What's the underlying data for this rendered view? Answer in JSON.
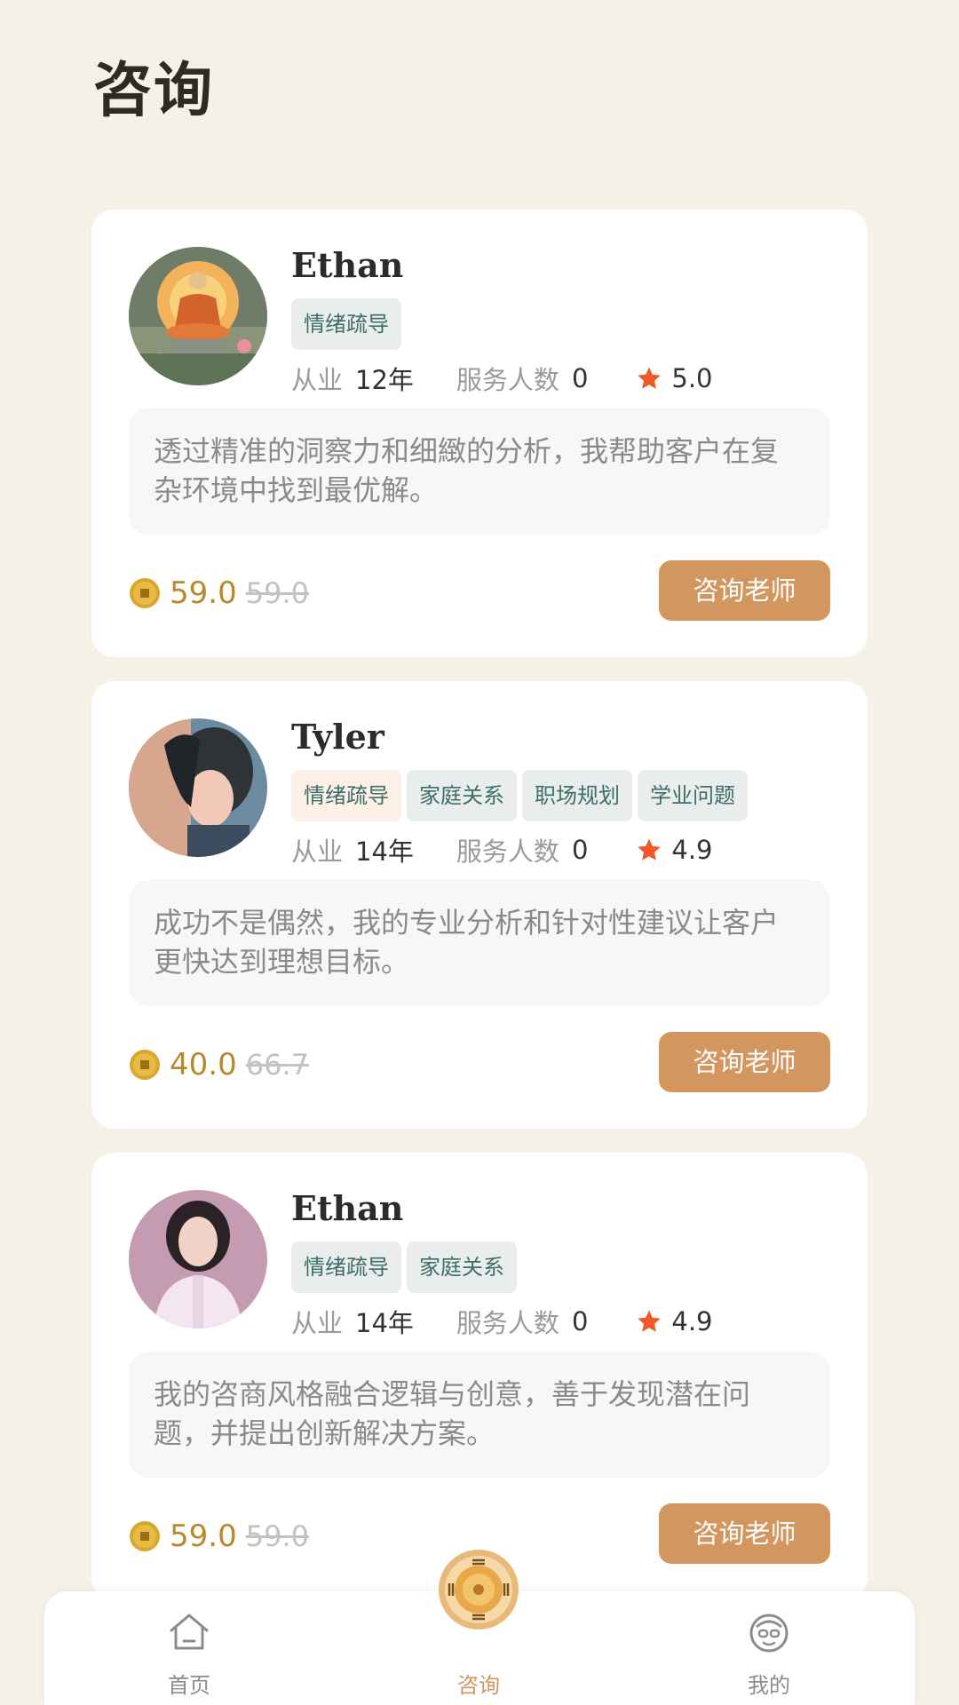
{
  "page": {
    "title": "咨询"
  },
  "counselors": [
    {
      "name": "Ethan",
      "tags": [
        {
          "label": "情绪疏导",
          "style": "default"
        }
      ],
      "years_label": "从业",
      "years_value": "12年",
      "served_label": "服务人数",
      "served_value": "0",
      "rating": "5.0",
      "description": "透过精准的洞察力和细緻的分析，我帮助客户在复杂环境中找到最优解。",
      "price": "59.0",
      "original_price": "59.0",
      "button_label": "咨询老师",
      "avatar_icon": "buddha-avatar"
    },
    {
      "name": "Tyler",
      "tags": [
        {
          "label": "情绪疏导",
          "style": "warm"
        },
        {
          "label": "家庭关系",
          "style": "default"
        },
        {
          "label": "职场规划",
          "style": "default"
        },
        {
          "label": "学业问题",
          "style": "default"
        }
      ],
      "years_label": "从业",
      "years_value": "14年",
      "served_label": "服务人数",
      "served_value": "0",
      "rating": "4.9",
      "description": "成功不是偶然，我的专业分析和针对性建议让客户更快达到理想目标。",
      "price": "40.0",
      "original_price": "66.7",
      "button_label": "咨询老师",
      "avatar_icon": "woman-portrait-avatar"
    },
    {
      "name": "Ethan",
      "tags": [
        {
          "label": "情绪疏导",
          "style": "default"
        },
        {
          "label": "家庭关系",
          "style": "default"
        }
      ],
      "years_label": "从业",
      "years_value": "14年",
      "served_label": "服务人数",
      "served_value": "0",
      "rating": "4.9",
      "description": "我的咨商风格融合逻辑与创意，善于发现潜在问题，并提出创新解决方案。",
      "price": "59.0",
      "original_price": "59.0",
      "button_label": "咨询老师",
      "avatar_icon": "woman-pink-avatar"
    }
  ],
  "bottom_nav": {
    "items": [
      {
        "label": "首页",
        "icon": "home-icon",
        "active": false
      },
      {
        "label": "咨询",
        "icon": "bagua-compass-icon",
        "active": true
      },
      {
        "label": "我的",
        "icon": "profile-face-icon",
        "active": false
      }
    ]
  },
  "colors": {
    "background": "#f6f1e7",
    "accent": "#d4965f",
    "price": "#b8892c",
    "tag_text": "#3e6e6a",
    "star": "#f0582a"
  }
}
